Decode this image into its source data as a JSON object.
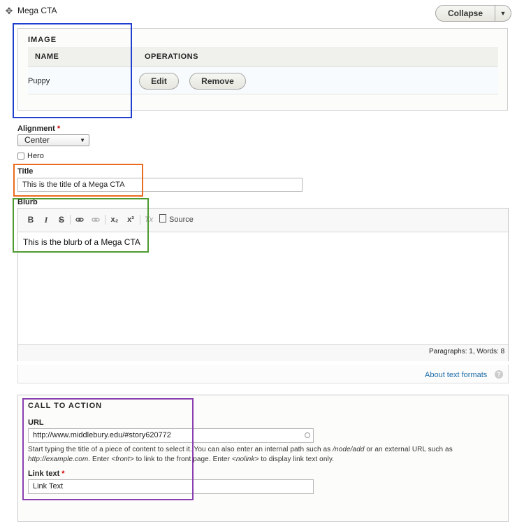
{
  "header": {
    "move_icon": "move-icon",
    "paragraph_title": "Mega CTA",
    "collapse_label": "Collapse",
    "dropdown_icon": "chevron-down-icon"
  },
  "image_field": {
    "legend": "IMAGE",
    "columns": [
      "NAME",
      "OPERATIONS"
    ],
    "rows": [
      {
        "name": "Puppy",
        "edit_label": "Edit",
        "remove_label": "Remove"
      }
    ]
  },
  "alignment": {
    "label": "Alignment",
    "required_mark": "*",
    "selected": "Center"
  },
  "hero": {
    "label": "Hero",
    "checked": false
  },
  "title_field": {
    "label": "Title",
    "value": "This is the title of a Mega CTA"
  },
  "blurb": {
    "label": "Blurb",
    "toolbar": {
      "bold": "B",
      "italic": "I",
      "strike": "S",
      "link_icon": "link-icon",
      "unlink_icon": "unlink-icon",
      "subscript": "x₂",
      "superscript": "x²",
      "clear_format": "Tx",
      "source_label": "Source"
    },
    "content": "This is the blurb of a Mega CTA",
    "status": "Paragraphs: 1, Words: 8"
  },
  "formats": {
    "about_link": "About text formats",
    "help_icon": "help-icon"
  },
  "call_to_action": {
    "legend": "CALL TO ACTION",
    "url_label": "URL",
    "url_value": "http://www.middlebury.edu/#story620772",
    "help": {
      "p1": "Start typing the title of a piece of content to select it. You can also enter an internal path such as ",
      "p2": "/node/add",
      "p3": " or an external URL such as ",
      "p4": "http://example.com",
      "p5": ". Enter ",
      "p6": "<front>",
      "p7": " to link to the front page. Enter ",
      "p8": "<nolink>",
      "p9": " to display link text only."
    },
    "link_text_label": "Link text",
    "required_mark": "*",
    "link_text_value": "Link Text"
  },
  "colors": {
    "highlight_image": "#1f3fcf",
    "highlight_title": "#ea6b1f",
    "highlight_blurb": "#4c9b30",
    "highlight_cta": "#8a3fb0",
    "link": "#1a6ba6",
    "required": "#cc0000"
  }
}
